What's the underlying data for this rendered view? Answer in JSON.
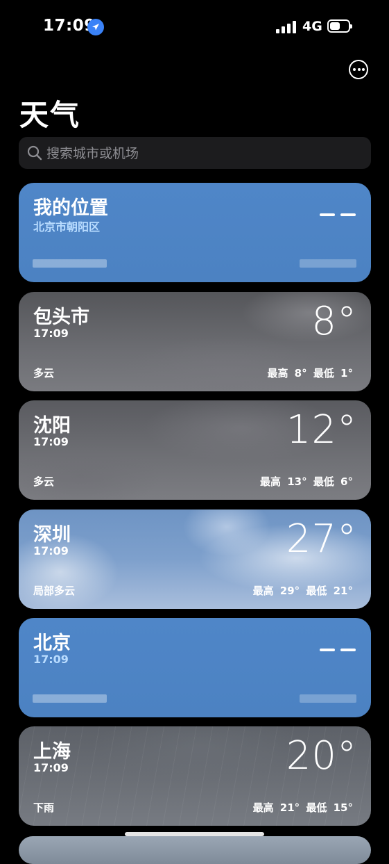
{
  "status_bar": {
    "time": "17:09",
    "network": "4G",
    "location_icon": "location-arrow-icon",
    "signal_icon": "cellular-signal-icon",
    "battery_icon": "battery-icon"
  },
  "header": {
    "title": "天气",
    "more_icon": "ellipsis-circle-icon"
  },
  "search": {
    "placeholder": "搜索城市或机场",
    "icon": "search-icon"
  },
  "cities": [
    {
      "name": "我的位置",
      "subtitle": "北京市朝阳区",
      "temperature": "– –",
      "condition": "",
      "hilo": "",
      "style": "loading"
    },
    {
      "name": "包头市",
      "subtitle": "17:09",
      "temperature": "8°",
      "condition": "多云",
      "hilo": "最高 8° 最低 1°",
      "style": "cloudy"
    },
    {
      "name": "沈阳",
      "subtitle": "17:09",
      "temperature": "12°",
      "condition": "多云",
      "hilo": "最高 13° 最低 6°",
      "style": "cloudy"
    },
    {
      "name": "深圳",
      "subtitle": "17:09",
      "temperature": "27°",
      "condition": "局部多云",
      "hilo": "最高 29° 最低 21°",
      "style": "partly-cloudy"
    },
    {
      "name": "北京",
      "subtitle": "17:09",
      "temperature": "– –",
      "condition": "",
      "hilo": "",
      "style": "loading"
    },
    {
      "name": "上海",
      "subtitle": "17:09",
      "temperature": "20°",
      "condition": "下雨",
      "hilo": "最高 21° 最低 15°",
      "style": "rain"
    }
  ],
  "colors": {
    "background": "#000000",
    "loading_card": "#4f86c8",
    "accent_blue": "#3a82f7",
    "search_bg": "#1c1c1e"
  }
}
